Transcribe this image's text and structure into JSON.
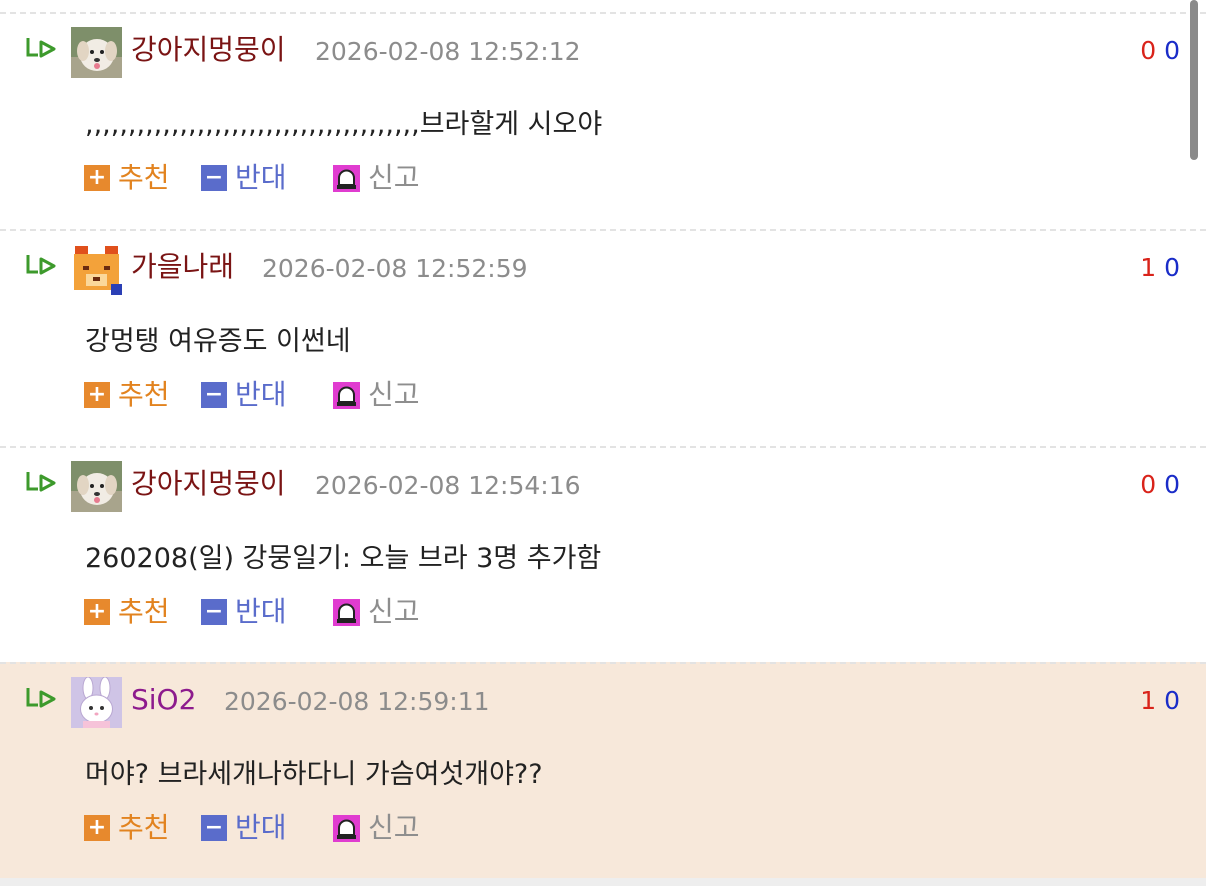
{
  "comments": [
    {
      "author": "강아지멍뭉이",
      "date": "2026-02-08 12:52:12",
      "up": "0",
      "down": "0",
      "text": ",,,,,,,,,,,,,,,,,,,,,,,,,,,,,,,,,,,,,,,브라할게 시오야",
      "avatar": "puppy-avatar"
    },
    {
      "author": "가을나래",
      "date": "2026-02-08 12:52:59",
      "up": "1",
      "down": "0",
      "text": "강멍탱 여유증도 이썬네",
      "avatar": "pixel-bear-avatar"
    },
    {
      "author": "강아지멍뭉이",
      "date": "2026-02-08 12:54:16",
      "up": "0",
      "down": "0",
      "text": "260208(일) 강뭉일기: 오늘 브라 3명 추가함",
      "avatar": "puppy-avatar"
    },
    {
      "author": "SiO2",
      "date": "2026-02-08 12:59:11",
      "up": "1",
      "down": "0",
      "text": "머야? 브라세개나하다니 가슴여섯개야??",
      "avatar": "bunny-avatar"
    }
  ],
  "actions": {
    "recommend": "추천",
    "oppose": "반대",
    "report": "신고",
    "plus_glyph": "+",
    "minus_glyph": "−"
  },
  "colors": {
    "author": "#7a1414",
    "author_highlight": "#8d1b8d",
    "date": "#8c8c8c",
    "upvote": "#d9231a",
    "downvote": "#1a2cc8",
    "recommend": "#e7892d",
    "oppose": "#5a6ccb",
    "reply_arrow": "#3d9a2c",
    "highlight_background": "#f7e8da"
  },
  "icons": {
    "reply": "reply-arrow-icon",
    "recommend": "plus-square-icon",
    "oppose": "minus-square-icon",
    "report": "siren-icon"
  }
}
